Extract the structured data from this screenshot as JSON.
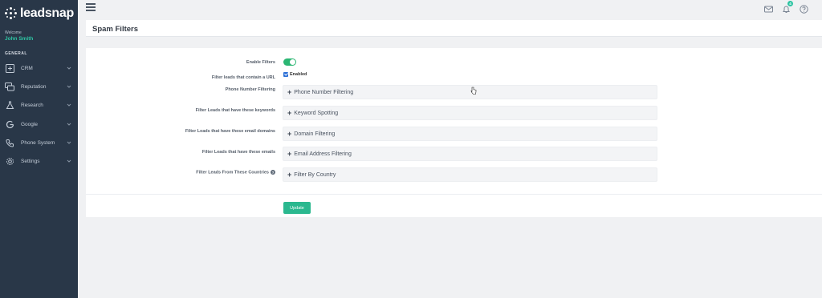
{
  "sidebar": {
    "brand": "leadsnap",
    "welcome": "Welcome",
    "user_name": "John Smith",
    "section": "GENERAL",
    "items": [
      {
        "label": "CRM",
        "icon": "plus-box-icon"
      },
      {
        "label": "Reputation",
        "icon": "reputation-icon"
      },
      {
        "label": "Research",
        "icon": "flask-icon"
      },
      {
        "label": "Google",
        "icon": "google-icon"
      },
      {
        "label": "Phone System",
        "icon": "phone-icon"
      },
      {
        "label": "Settings",
        "icon": "gear-icon"
      }
    ]
  },
  "topbar": {
    "notification_count": "4",
    "icons": [
      "menu-icon",
      "mail-icon",
      "bell-icon",
      "help-icon"
    ]
  },
  "page": {
    "title": "Spam Filters"
  },
  "form": {
    "enable_filters_label": "Enable Filters",
    "enable_filters_on": true,
    "url_filter_label": "Filter leads that contain a URL",
    "url_filter_checkbox": "Enabled",
    "phone_label": "Phone Number Filtering",
    "phone_accordion": "Phone Number Filtering",
    "keywords_label": "Filter Leads that have these keywords",
    "keywords_accordion": "Keyword Spotting",
    "domains_label": "Filter Leads that have these email domains",
    "domains_accordion": "Domain Filtering",
    "emails_label": "Filter Leads that have these emails",
    "emails_accordion": "Email Address Filtering",
    "countries_label": "Filter Leads From These Countries",
    "countries_accordion": "Filter By Country",
    "update_button": "Update"
  },
  "colors": {
    "sidebar_bg": "#293748",
    "accent": "#2ec4a3",
    "toggle_on": "#2bb673",
    "button": "#2bb88f"
  }
}
